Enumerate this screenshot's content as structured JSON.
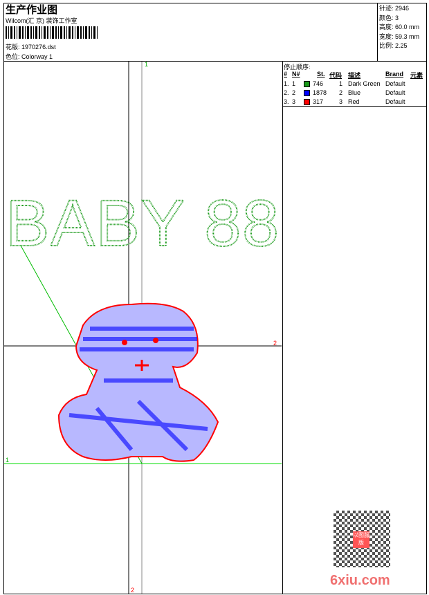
{
  "header": {
    "title": "生产作业图",
    "company": "Wilcom(汇 京) 装饰工作室",
    "design_label": "花版:",
    "design_file": "1970276.dst",
    "colorway_label": "色位:",
    "colorway": "Colorway 1"
  },
  "stats": [
    {
      "label": "针迹:",
      "value": "2946"
    },
    {
      "label": "颜色:",
      "value": "3"
    },
    {
      "label": "高度:",
      "value": "60.0 mm"
    },
    {
      "label": "宽度:",
      "value": "59.3 mm"
    },
    {
      "label": "比例:",
      "value": "2.25"
    }
  ],
  "stop_sequence": {
    "title": "停止顺序:",
    "columns": [
      "#",
      "N#",
      "St.",
      "代码",
      "描述",
      "Brand",
      "元素"
    ],
    "rows": [
      {
        "idx": "1.",
        "n": "1",
        "color": "#1a9a1a",
        "st": "746",
        "code": "1",
        "desc": "Dark Green",
        "brand": "Default"
      },
      {
        "idx": "2.",
        "n": "2",
        "color": "#0000ff",
        "st": "1878",
        "code": "2",
        "desc": "Blue",
        "brand": "Default"
      },
      {
        "idx": "3.",
        "n": "3",
        "color": "#ff0000",
        "st": "317",
        "code": "3",
        "desc": "Red",
        "brand": "Default"
      }
    ]
  },
  "design": {
    "text": "BABY 88"
  },
  "markers": {
    "top": "1",
    "right": "2",
    "left": "1",
    "bottom": "2"
  },
  "watermark": {
    "site": "6xiu.com",
    "seal": "以图服版"
  }
}
